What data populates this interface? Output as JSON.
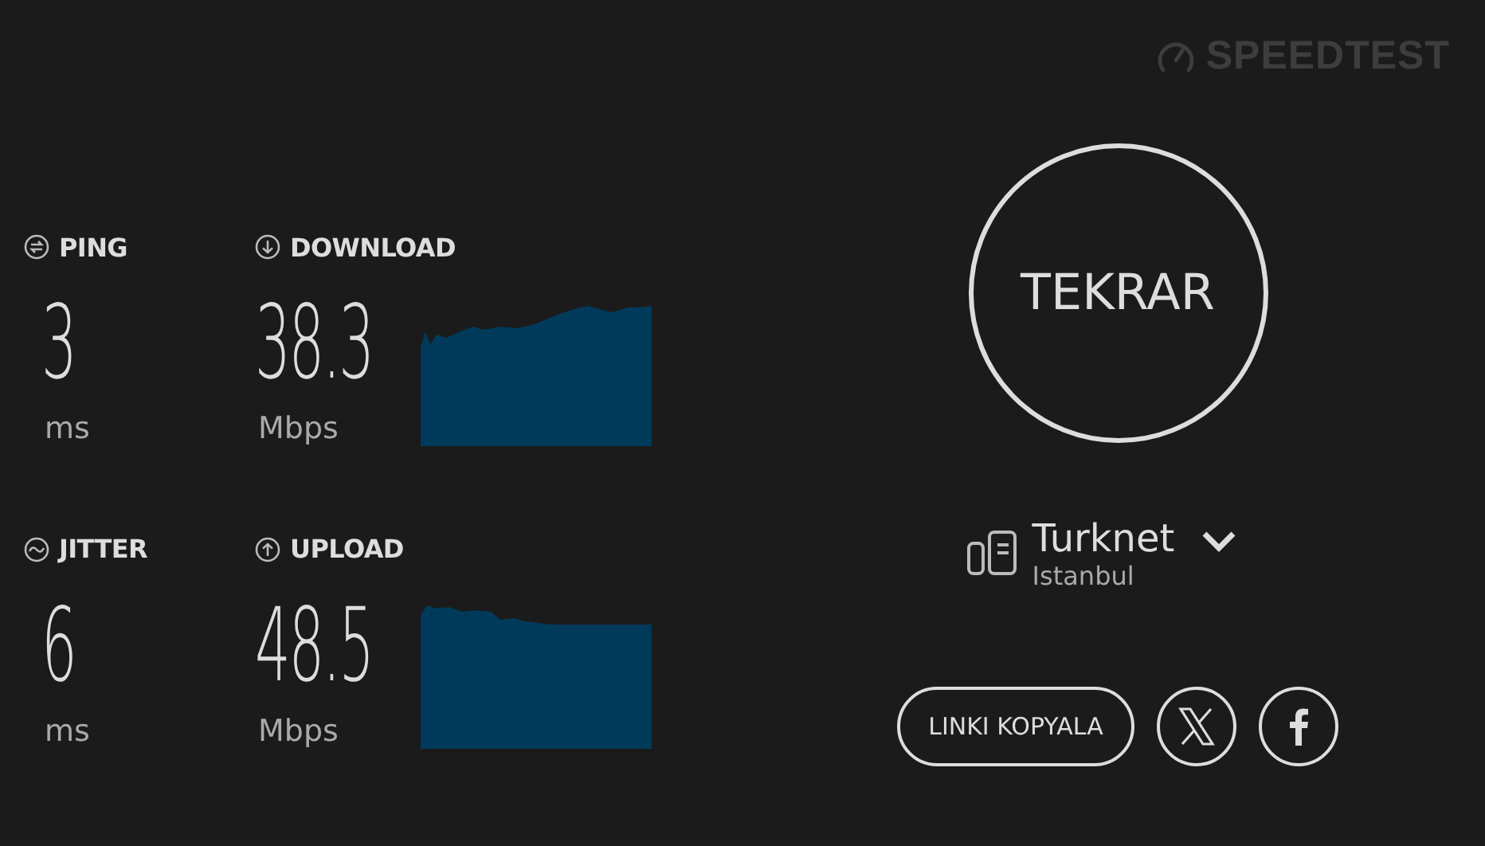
{
  "brand": {
    "name": "SPEEDTEST"
  },
  "metrics": [
    {
      "kind": "ping",
      "label": "PING",
      "value": "3",
      "unit": "ms"
    },
    {
      "kind": "download",
      "label": "DOWNLOAD",
      "value": "38.3",
      "unit": "Mbps"
    },
    {
      "kind": "jitter",
      "label": "JITTER",
      "value": "6",
      "unit": "ms"
    },
    {
      "kind": "upload",
      "label": "UPLOAD",
      "value": "48.5",
      "unit": "Mbps"
    }
  ],
  "again_button": {
    "label": "TEKRAR"
  },
  "server": {
    "name": "Turknet",
    "location": "Istanbul"
  },
  "share": {
    "copy_link": "LINKI KOPYALA"
  }
}
